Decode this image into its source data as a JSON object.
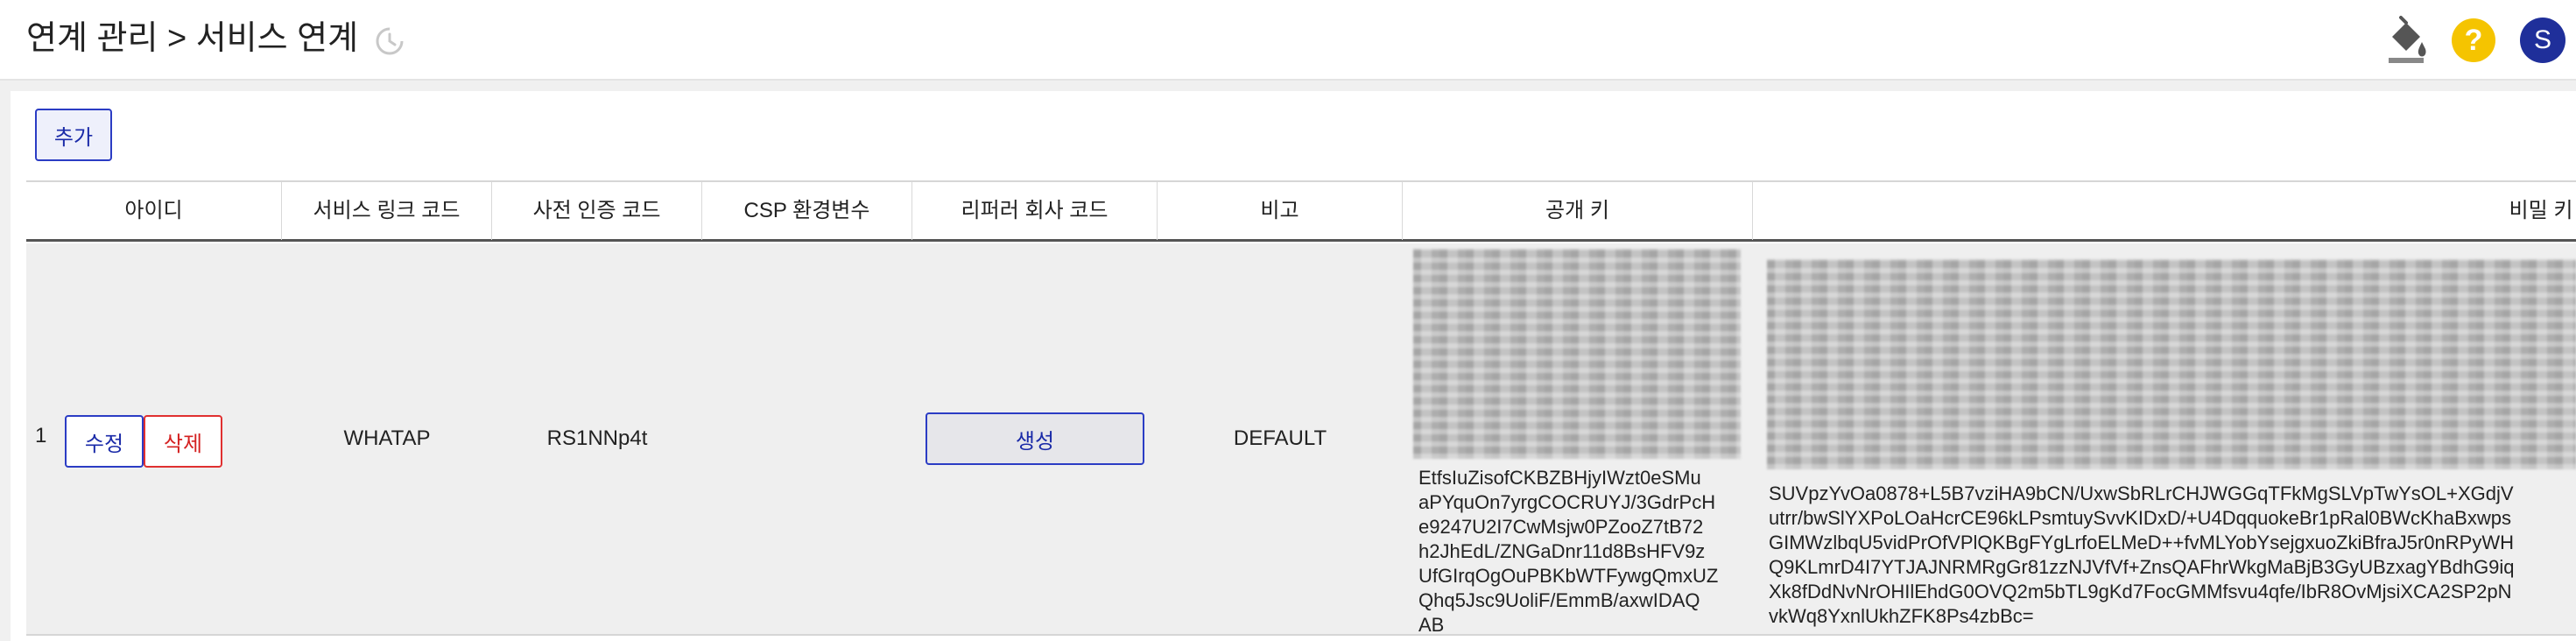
{
  "header": {
    "breadcrumb": "연계 관리 > 서비스 연계",
    "history_icon": "history-icon",
    "paint_icon": "paint-bucket-icon",
    "help_icon": "help-icon",
    "help_glyph": "?",
    "avatar_initial": "S",
    "colors": {
      "help": "#f5c400",
      "avatar": "#1f2f9a"
    }
  },
  "toolbar": {
    "add_label": "추가"
  },
  "table": {
    "columns": [
      "아이디",
      "서비스 링크 코드",
      "사전 인증 코드",
      "CSP 환경변수",
      "리퍼러 회사 코드",
      "비고",
      "공개 키",
      "비밀 키"
    ],
    "rows": [
      {
        "index": "1",
        "edit_label": "수정",
        "delete_label": "삭제",
        "service_link_code": "WHATAP",
        "pre_auth_code": "RS1NNp4t",
        "csp_env": "",
        "referrer_button": "생성",
        "note": "DEFAULT",
        "public_key_visible": "EtfsIuZisofCKBZBHjyIWzt0eSMu\naPYquOn7yrgCOCRUYJ/3GdrPcH\ne9247U2I7CwMsjw0PZooZ7tB72\nh2JhEdL/ZNGaDnr11d8BsHFV9z\nUfGIrqOgOuPBKbWTFywgQmxUZ\nQhq5Jsc9UoliF/EmmB/axwIDAQ\nAB",
        "secret_key_visible": "SUVpzYvOa0878+L5B7vziHA9bCN/UxwSbRLrCHJWGGqTFkMgSLVpTwYsOL+XGdjV\nutrr/bwSlYXPoLOaHcrCE96kLPsmtuySvvKIDxD/+U4DqquokeBr1pRal0BWcKhaBxwps\nGIMWzlbqU5vidPrOfVPlQKBgFYgLrfoELMeD++fvMLYobYsejgxuoZkiBfraJ5r0nRPyWH\nQ9KLmrD4I7YTJAJNRMRgGr81zzNJVfVf+ZnsQAFhrWkgMaBjB3GyUBzxagYBdhG9iq\nXk8fDdNvNrOHIlEhdG0OVQ2m5bTL9gKd7FocGMMfsvu4qfe/IbR8OvMjsiXCA2SP2pN\nvkWq8YxnlUkhZFK8Ps4zbBc="
      }
    ]
  }
}
